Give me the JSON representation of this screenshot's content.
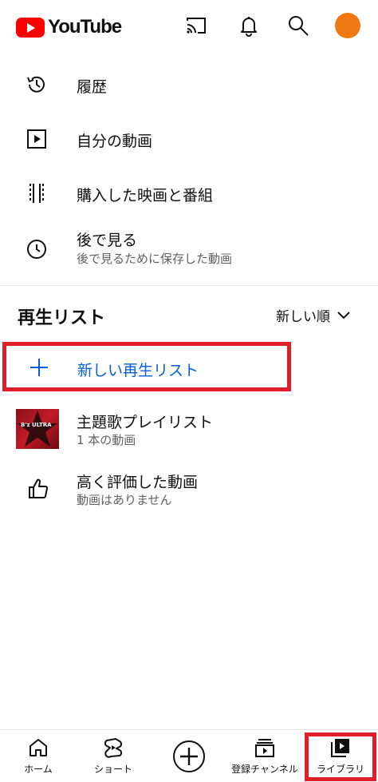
{
  "header": {
    "logo_text": "YouTube",
    "icons": [
      "cast-icon",
      "bell-icon",
      "search-icon",
      "avatar"
    ],
    "avatar_color": "#f07813",
    "brand_color": "#ff0000"
  },
  "menu": [
    {
      "label": "履歴",
      "icon": "history-icon"
    },
    {
      "label": "自分の動画",
      "icon": "play-icon"
    },
    {
      "label": "購入した映画と番組",
      "icon": "film-icon"
    },
    {
      "label": "後で見る",
      "sub": "後で見るために保存した動画",
      "icon": "clock-icon"
    }
  ],
  "playlists": {
    "title": "再生リスト",
    "sort_label": "新しい順",
    "new_playlist_label": "新しい再生リスト",
    "items": [
      {
        "title": "主題歌プレイリスト",
        "sub": "1 本の動画",
        "thumb_text": "B'z ULTRA"
      },
      {
        "title": "高く評価した動画",
        "sub": "動画はありません",
        "icon": "thumbs-up-icon"
      }
    ]
  },
  "bottom_nav": [
    {
      "label": "ホーム",
      "icon": "home-icon"
    },
    {
      "label": "ショート",
      "icon": "shorts-icon"
    },
    {
      "label": "",
      "icon": "create-icon"
    },
    {
      "label": "登録チャンネル",
      "icon": "subscriptions-icon"
    },
    {
      "label": "ライブラリ",
      "icon": "library-icon"
    }
  ],
  "highlight_color": "#e01e2a",
  "link_color": "#065fd4"
}
